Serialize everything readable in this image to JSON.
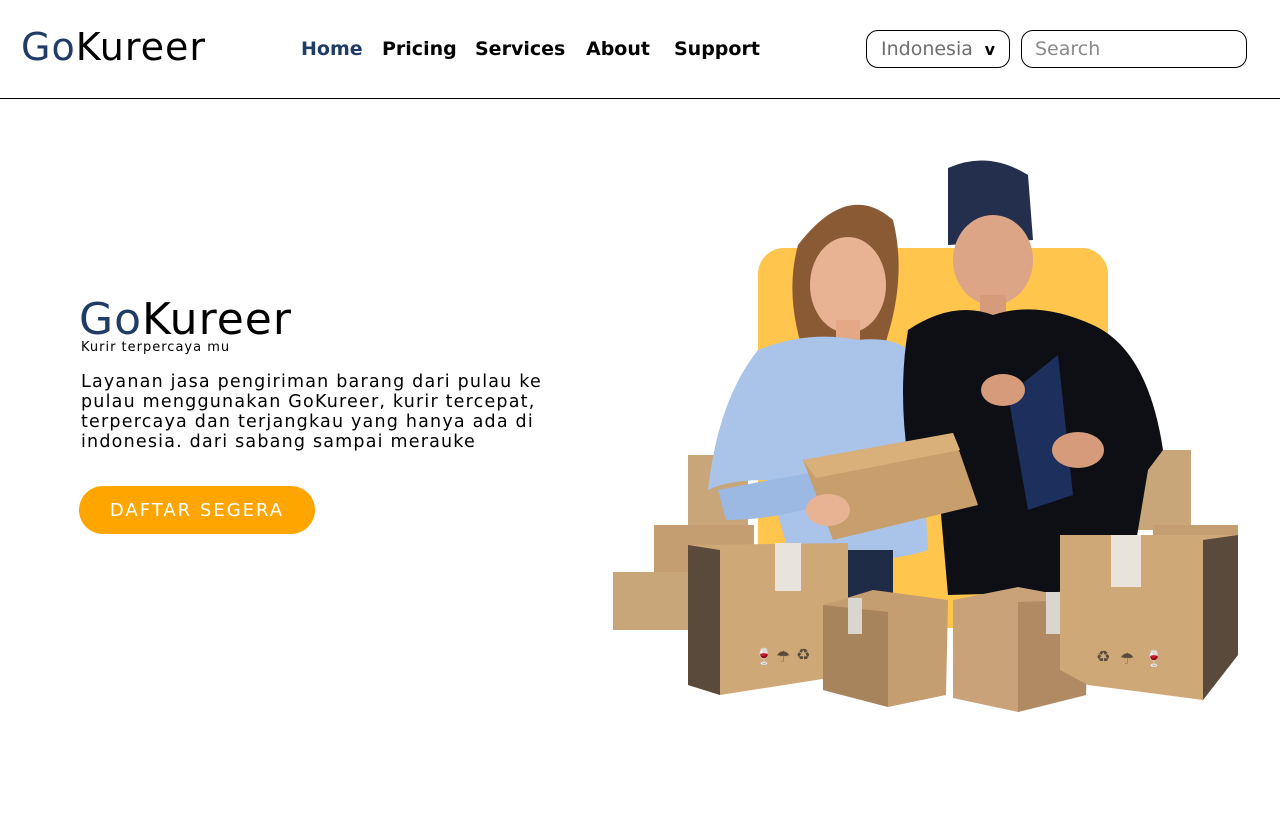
{
  "header": {
    "logo": {
      "go": "Go",
      "kureer": "Kureer"
    },
    "nav": [
      {
        "label": "Home",
        "active": true
      },
      {
        "label": "Pricing",
        "active": false
      },
      {
        "label": "Services",
        "active": false
      },
      {
        "label": "About",
        "active": false
      },
      {
        "label": "Support",
        "active": false
      }
    ],
    "country_select": {
      "value": "Indonesia",
      "chevron": "v"
    },
    "search": {
      "placeholder": "Search"
    }
  },
  "hero": {
    "logo": {
      "go": "Go",
      "kureer": "Kureer"
    },
    "tagline": "Kurir terpercaya mu",
    "description": "Layanan jasa pengiriman barang dari pulau ke pulau menggunakan GoKureer, kurir tercepat, terpercaya dan terjangkau yang hanya ada di indonesia. dari sabang sampai merauke",
    "cta_label": "DAFTAR SEGERA"
  },
  "colors": {
    "brand_blue": "#1f3c66",
    "accent_orange": "#ffa500",
    "illustration_yellow": "#ffc54d"
  },
  "icons": [
    "chevron-down-icon",
    "fragile-icon",
    "keep-dry-icon",
    "recycle-icon"
  ]
}
